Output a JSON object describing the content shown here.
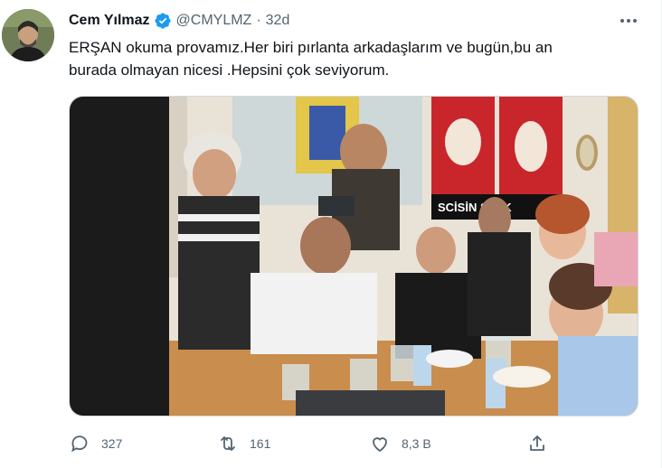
{
  "author": {
    "display_name": "Cem Yılmaz",
    "handle": "@CMYLMZ",
    "separator": "·",
    "time": "32d"
  },
  "tweet": {
    "line1": "ERŞAN okuma provamız.Her biri pırlanta arkadaşlarım ve bugün,bu an",
    "line2": "burada olmayan nicesi .Hepsini çok seviyorum."
  },
  "poster_text": "SCİSİN S      ÇİK",
  "actions": {
    "reply_count": "327",
    "retweet_count": "161",
    "like_count": "8,3 B"
  },
  "icons": [
    "verified-badge-icon",
    "more-icon",
    "reply-icon",
    "retweet-icon",
    "like-icon",
    "share-icon"
  ],
  "colors": {
    "verified": "#1d9bf0",
    "text_primary": "#0f1419",
    "text_secondary": "#536471"
  }
}
